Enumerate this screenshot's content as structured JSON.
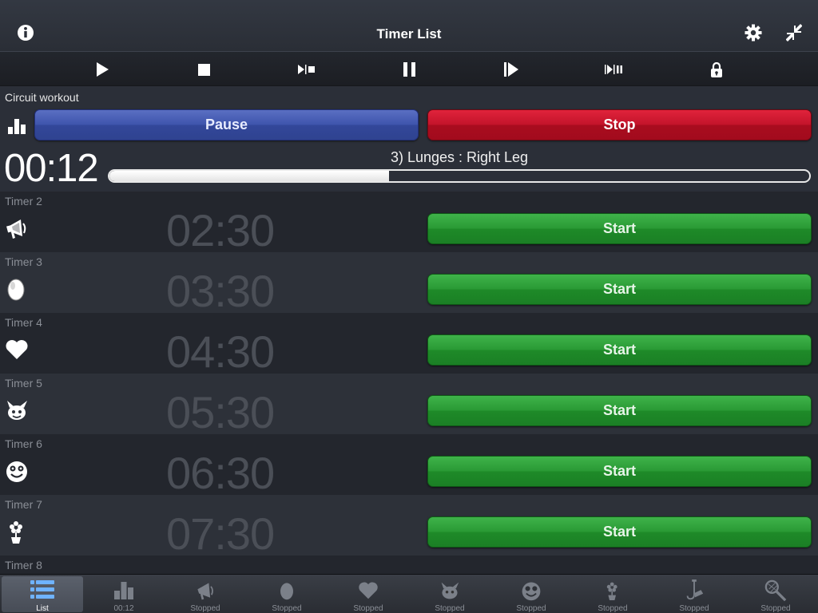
{
  "header": {
    "title": "Timer List"
  },
  "active": {
    "name": "Circuit workout",
    "pause_label": "Pause",
    "stop_label": "Stop",
    "time": "00:12",
    "step": "3) Lunges : Right Leg",
    "progress": 0.4
  },
  "timers": [
    {
      "name": "Timer 2",
      "time": "02:30",
      "icon": "megaphone-icon",
      "start_label": "Start"
    },
    {
      "name": "Timer 3",
      "time": "03:30",
      "icon": "egg-icon",
      "start_label": "Start"
    },
    {
      "name": "Timer 4",
      "time": "04:30",
      "icon": "heart-icon",
      "start_label": "Start"
    },
    {
      "name": "Timer 5",
      "time": "05:30",
      "icon": "devil-icon",
      "start_label": "Start"
    },
    {
      "name": "Timer 6",
      "time": "06:30",
      "icon": "smiley-icon",
      "start_label": "Start"
    },
    {
      "name": "Timer 7",
      "time": "07:30",
      "icon": "flower-pot-icon",
      "start_label": "Start"
    },
    {
      "name": "Timer 8"
    }
  ],
  "tabs": [
    {
      "label": "List",
      "icon": "list-icon",
      "active": true
    },
    {
      "label": "00:12",
      "icon": "chart-icon"
    },
    {
      "label": "Stopped",
      "icon": "megaphone-icon"
    },
    {
      "label": "Stopped",
      "icon": "egg-icon"
    },
    {
      "label": "Stopped",
      "icon": "heart-icon"
    },
    {
      "label": "Stopped",
      "icon": "devil-icon"
    },
    {
      "label": "Stopped",
      "icon": "smiley-icon"
    },
    {
      "label": "Stopped",
      "icon": "flower-pot-icon"
    },
    {
      "label": "Stopped",
      "icon": "saxophone-icon"
    },
    {
      "label": "Stopped",
      "icon": "racket-icon"
    }
  ],
  "colors": {
    "pause": "#3f55ad",
    "stop": "#c4142b",
    "start": "#2a9a35",
    "background": "#2b2f38"
  }
}
